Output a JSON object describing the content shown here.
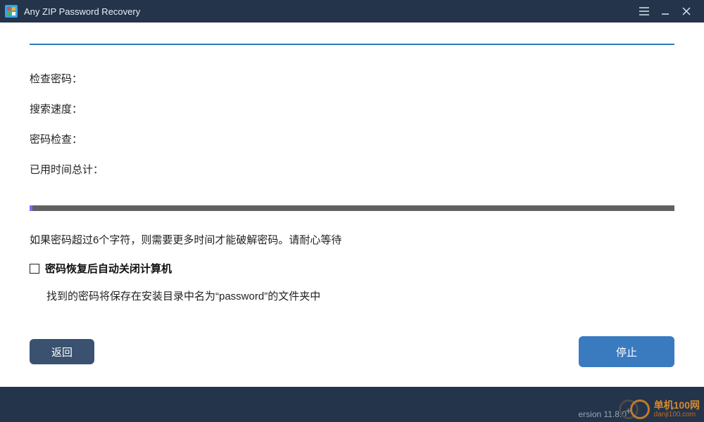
{
  "titlebar": {
    "title": "Any ZIP Password Recovery"
  },
  "fields": {
    "check_password_label": "检查密码：",
    "search_speed_label": "搜索速度：",
    "password_check_label": "密码检查：",
    "elapsed_total_label": "已用时间总计："
  },
  "note_text": "如果密码超过6个字符，则需要更多时间才能破解密码。请耐心等待",
  "shutdown_checkbox_label": "密码恢复后自动关闭计算机",
  "password_folder_note": "找到的密码将保存在安装目录中名为“password”的文件夹中",
  "buttons": {
    "back": "返回",
    "stop": "停止"
  },
  "footer": {
    "version": "ersion 11.8.0"
  },
  "watermark": {
    "line1": "单机100网",
    "line2": "danji100.com"
  },
  "colors": {
    "titlebar_bg": "#23344b",
    "primary_button": "#3a7bc0",
    "secondary_button": "#3a5170",
    "rule": "#2a7bbf",
    "progress_fill": "#7a6cff",
    "progress_track": "#616161"
  }
}
